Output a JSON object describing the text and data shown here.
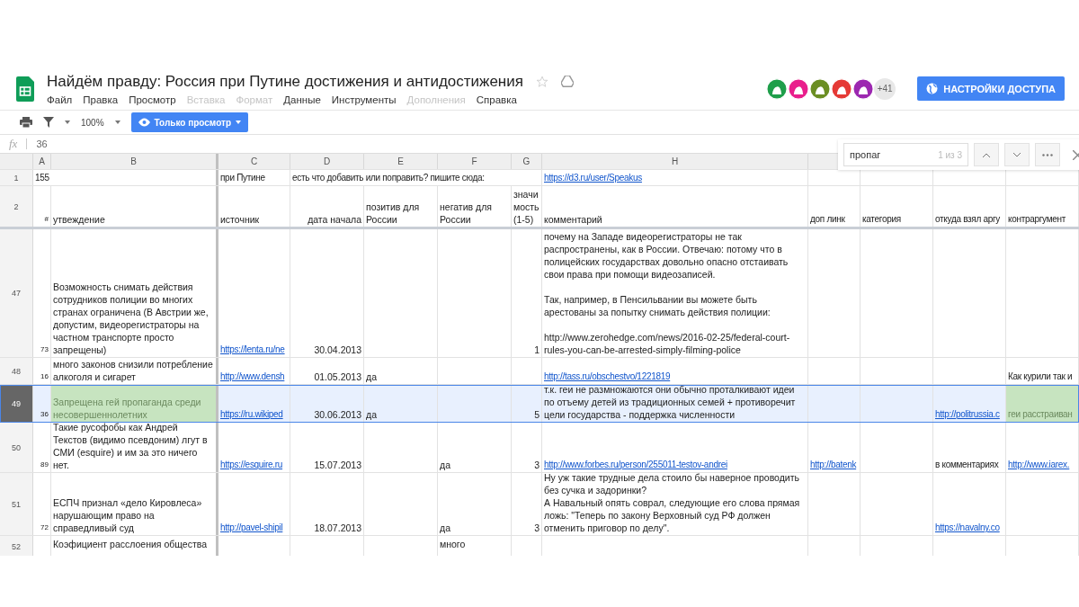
{
  "document": {
    "title": "Найдём правду: Россия при Путине достижения и антидостижения"
  },
  "menu": [
    {
      "label": "Файл",
      "disabled": false
    },
    {
      "label": "Правка",
      "disabled": false
    },
    {
      "label": "Просмотр",
      "disabled": false
    },
    {
      "label": "Вставка",
      "disabled": true
    },
    {
      "label": "Формат",
      "disabled": true
    },
    {
      "label": "Данные",
      "disabled": false
    },
    {
      "label": "Инструменты",
      "disabled": false
    },
    {
      "label": "Дополнения",
      "disabled": true
    },
    {
      "label": "Справка",
      "disabled": false
    }
  ],
  "collaborators": [
    {
      "color": "#1e9e4a"
    },
    {
      "color": "#e91e8c"
    },
    {
      "color": "#6b8e23"
    },
    {
      "color": "#e53935"
    },
    {
      "color": "#9c27b0"
    }
  ],
  "collaborators_more": "+41",
  "share_button": "НАСТРОЙКИ ДОСТУПА",
  "toolbar": {
    "zoom": "100%",
    "mode_button": "Только просмотр"
  },
  "formula_bar": {
    "label": "fx",
    "value": "36"
  },
  "find": {
    "value": "пропаг",
    "count": "1 из 3"
  },
  "columns": [
    "A",
    "B",
    "C",
    "D",
    "E",
    "F",
    "G",
    "H"
  ],
  "rows": [
    {
      "number": "1",
      "selected": false,
      "cells": [
        {
          "text": "155"
        },
        {},
        {
          "text": "при Путине"
        },
        {
          "text": "есть что добавить или поправить? пишите сюда:"
        },
        {},
        {},
        {},
        {
          "text": "https://d3.ru/user/Speakus",
          "link": true
        },
        {},
        {},
        {},
        {}
      ]
    },
    {
      "number": "2",
      "selected": false,
      "cells": [
        {
          "text": "#"
        },
        {
          "text": "утвеждение"
        },
        {
          "text": "источник"
        },
        {
          "text": "дата начала"
        },
        {
          "text": "позитив для России"
        },
        {
          "text": "негатив для России"
        },
        {
          "text": "значи мость (1-5)"
        },
        {
          "text": "комментарий"
        },
        {
          "text": "доп линк"
        },
        {
          "text": "категория"
        },
        {
          "text": "откуда взял аргу"
        },
        {
          "text": "контраргумент"
        }
      ]
    },
    {
      "number": "47",
      "selected": false,
      "cells": [
        {
          "text": "73"
        },
        {
          "text": "Возможность снимать действия сотрудников полиции во многих странах ограничена (В Австрии же, допустим, видеорегистраторы на частном транспорте просто запрещены)"
        },
        {
          "text": "https://lenta.ru/ne",
          "link": true
        },
        {
          "text": "30.04.2013"
        },
        {},
        {},
        {
          "text": "1"
        },
        {
          "text": "почему на Западе видеорегистраторы не так распространены, как в России. Отвечаю: потому что в полицейских государствах довольно опасно отстаивать свои права при помощи видеозаписей.\n\nТак, например, в Пенсильвании вы можете быть арестованы за попытку снимать действия полиции:\n\nhttp://www.zerohedge.com/news/2016-02-25/federal-court-rules-you-can-be-arrested-simply-filming-police"
        },
        {},
        {},
        {},
        {}
      ]
    },
    {
      "number": "48",
      "selected": false,
      "cells": [
        {
          "text": "16"
        },
        {
          "text": "много законов снизили потребление алкоголя и сигарет"
        },
        {
          "text": "http://www.densh",
          "link": true
        },
        {
          "text": "01.05.2013"
        },
        {
          "text": "да"
        },
        {},
        {},
        {
          "text": "http://tass.ru/obschestvo/1221819",
          "link": true
        },
        {},
        {},
        {},
        {
          "text": "Как курили так и"
        }
      ]
    },
    {
      "number": "49",
      "selected": true,
      "cells": [
        {
          "text": "36"
        },
        {
          "text": "Запрещена гей пропаганда среди несовершеннолетних",
          "highlight": true
        },
        {
          "text": "https://ru.wikiped",
          "link": true
        },
        {
          "text": "30.06.2013"
        },
        {
          "text": "да"
        },
        {},
        {
          "text": "5"
        },
        {
          "text": "т.к. геи не размножаются они обычно проталкивают идеи по отъему детей из традиционных семей + противоречит цели государства - поддержка численности"
        },
        {},
        {},
        {
          "text": "http://politrussia.c",
          "link": true
        },
        {
          "text": "геи расстраиван",
          "highlight": true
        }
      ]
    },
    {
      "number": "50",
      "selected": false,
      "cells": [
        {
          "text": "89"
        },
        {
          "text": "Такие русофобы как Андрей Текстов (видимо псевдоним) лгут в СМИ (esquire) и им за это ничего нет."
        },
        {
          "text": "https://esquire.ru",
          "link": true
        },
        {
          "text": "15.07.2013"
        },
        {},
        {
          "text": "да"
        },
        {
          "text": "3"
        },
        {
          "text": "http://www.forbes.ru/person/255011-testov-andrei",
          "link": true
        },
        {
          "text": "http://batenk",
          "link": true
        },
        {},
        {
          "text": "в комментариях"
        },
        {
          "text": "http://www.iarex.",
          "link": true
        }
      ]
    },
    {
      "number": "51",
      "selected": false,
      "cells": [
        {
          "text": "72"
        },
        {
          "text": "ЕСПЧ признал «дело Кировлеса» нарушающим право на справедливый суд"
        },
        {
          "text": "http://pavel-shipil",
          "link": true
        },
        {
          "text": "18.07.2013"
        },
        {},
        {
          "text": "да"
        },
        {
          "text": "3"
        },
        {
          "text": "Ну уж такие трудные дела стоило бы наверное проводить без сучка и задоринки?\nА Навальный опять соврал, следующие его слова прямая ложь: \"Теперь по закону Верховный суд РФ должен отменить приговор по делу\"."
        },
        {},
        {},
        {
          "text": "https://navalny.co",
          "link": true
        },
        {}
      ]
    },
    {
      "number": "52",
      "selected": false,
      "cells": [
        {},
        {
          "text": "Коэфициент расслоения общества"
        },
        {},
        {},
        {},
        {
          "text": "много"
        },
        {},
        {},
        {},
        {},
        {},
        {}
      ]
    }
  ]
}
